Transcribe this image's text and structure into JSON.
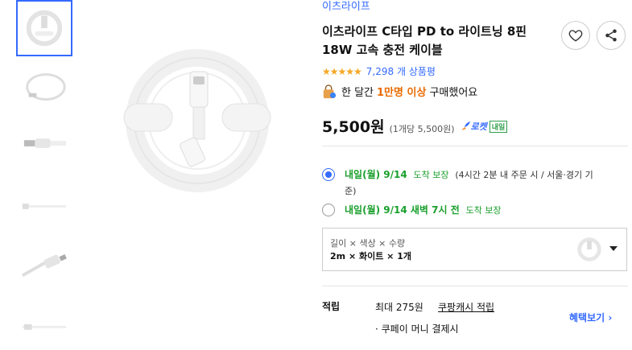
{
  "product": {
    "brand": "이츠라이프",
    "title_line1": "이츠라이프 C타입 PD to 라이트닝 8핀",
    "title_line2": "18W 고속 충전 케이블",
    "rating_stars": 4.5,
    "stars_text": "★★★★★",
    "review_count": "7,298 개 상품평",
    "monthly_prefix": "한 달간",
    "monthly_highlight": "1만명 이상",
    "monthly_suffix": "구매했어요",
    "price": "5,500원",
    "unit_price": "(1개당 5,500원)",
    "rocket_label": "로켓",
    "rocket_badge": "내일"
  },
  "actions": {
    "wishlist_icon": "heart-icon",
    "share_icon": "share-icon"
  },
  "delivery": {
    "option1_date": "내일(월) 9/14",
    "option1_type": "도착 보장",
    "option1_note": "(4시간 2분 내 주문 시 / 서울·경기 기",
    "option1_note2": "준)",
    "option2_date": "내일(월) 9/14 새벽 7시 전",
    "option2_type": "도착 보장"
  },
  "option_selector": {
    "label": "길이 × 색상 × 수량",
    "value": "2m × 화이트 × 1개"
  },
  "benefit": {
    "label": "적립",
    "max": "최대 275원",
    "link": "쿠팡캐시 적립",
    "more": "혜택보기 ›",
    "pay": "· 쿠페이 머니 결제시"
  },
  "colors": {
    "accent": "#346aff",
    "green": "#1a9f2c",
    "orange": "#e96b00",
    "star": "#f5a623"
  }
}
